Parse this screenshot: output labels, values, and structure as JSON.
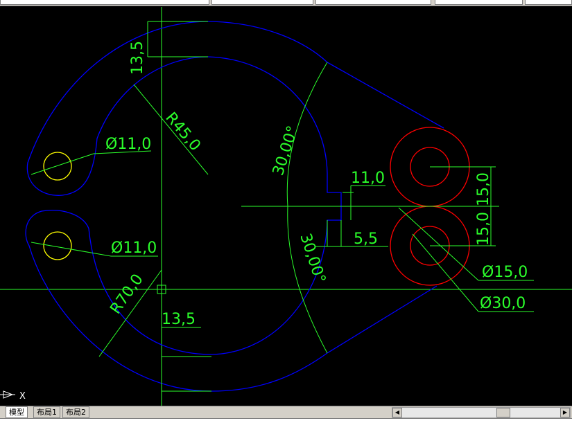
{
  "tabs": [
    {
      "label": "模型",
      "active": true
    },
    {
      "label": "布局1",
      "active": false
    },
    {
      "label": "布局2",
      "active": false
    }
  ],
  "dimensions": {
    "r45": "R45,0",
    "r70": "R70,0",
    "d11_top": "Ø11,0",
    "d11_bottom": "Ø11,0",
    "d15": "Ø15,0",
    "d30": "Ø30,0",
    "v13_5": "13,5",
    "h13_5": "13,5",
    "ang30_top": "30,00°",
    "ang30_bottom": "30,00°",
    "d11_0": "11,0",
    "d5_5": "5,5",
    "d15_0_a": "15,0",
    "d15_0_b": "15,0"
  },
  "ucs_axis_label": "X",
  "colors": {
    "background": "#000000",
    "outline": "#0000ff",
    "dimension": "#2bff2b",
    "circle_red": "#ff0000",
    "circle_yellow": "#ffff00"
  }
}
